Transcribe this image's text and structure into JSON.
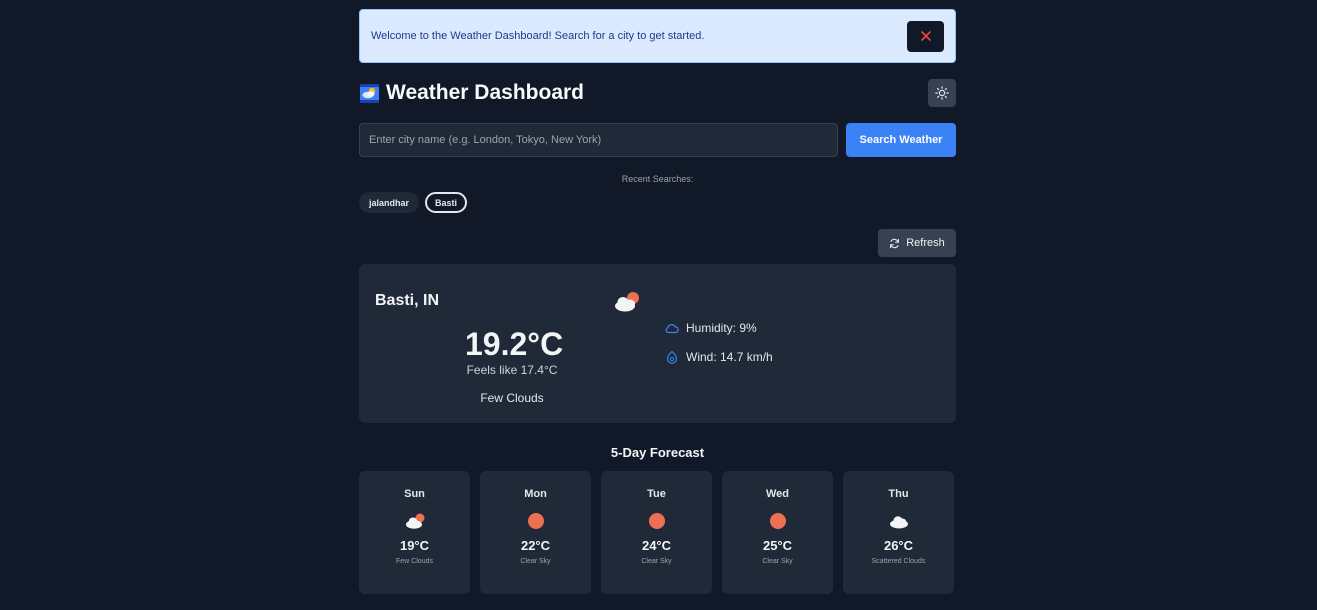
{
  "banner": {
    "message": "Welcome to the Weather Dashboard! Search for a city to get started.",
    "close_icon": "close-icon",
    "close_color": "#ef4444"
  },
  "header": {
    "title": "Weather Dashboard",
    "app_icon": "weather-app-icon",
    "theme_icon": "sun-icon"
  },
  "search": {
    "placeholder": "Enter city name (e.g. London, Tokyo, New York)",
    "value": "",
    "button_label": "Search Weather"
  },
  "recent": {
    "label": "Recent Searches:",
    "items": [
      "jalandhar",
      "Basti"
    ],
    "active": "Basti"
  },
  "refresh": {
    "label": "Refresh",
    "icon": "refresh-icon"
  },
  "current": {
    "city": "Basti, IN",
    "temperature": "19.2°C",
    "feels_like": "Feels like 17.4°C",
    "description": "Few Clouds",
    "icon": "few-clouds-icon",
    "humidity": "Humidity: 9%",
    "wind": "Wind: 14.7 km/h"
  },
  "forecast": {
    "title": "5-Day Forecast",
    "days": [
      {
        "day": "Sun",
        "temp": "19°C",
        "desc": "Few Clouds",
        "icon": "few-clouds"
      },
      {
        "day": "Mon",
        "temp": "22°C",
        "desc": "Clear Sky",
        "icon": "clear-sky"
      },
      {
        "day": "Tue",
        "temp": "24°C",
        "desc": "Clear Sky",
        "icon": "clear-sky"
      },
      {
        "day": "Wed",
        "temp": "25°C",
        "desc": "Clear Sky",
        "icon": "clear-sky"
      },
      {
        "day": "Thu",
        "temp": "26°C",
        "desc": "Scattered Clouds",
        "icon": "scattered-clouds"
      }
    ]
  },
  "colors": {
    "accent": "#3b82f6",
    "sun": "#ef6f53",
    "background": "#111827",
    "card": "#1f2937"
  }
}
